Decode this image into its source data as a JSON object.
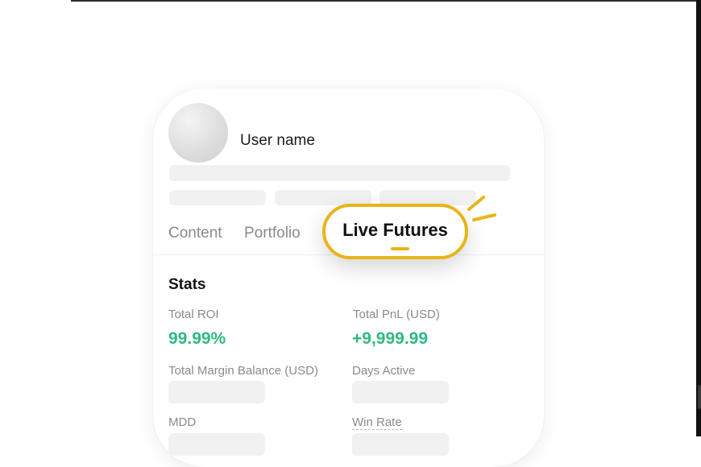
{
  "profile": {
    "user_name": "User name"
  },
  "tabs": {
    "content": "Content",
    "portfolio": "Portfolio",
    "live_futures": "Live Futures",
    "active": "Live Futures"
  },
  "stats": {
    "title": "Stats",
    "total_roi_label": "Total ROI",
    "total_roi_value": "99.99%",
    "total_pnl_label": "Total PnL (USD)",
    "total_pnl_value": "+9,999.99",
    "margin_balance_label": "Total Margin Balance (USD)",
    "days_active_label": "Days Active",
    "mdd_label": "MDD",
    "win_rate_label": "Win Rate"
  },
  "colors": {
    "accent_yellow": "#e9b516",
    "positive_green": "#2fb97f",
    "skeleton": "#f1f1f1"
  }
}
